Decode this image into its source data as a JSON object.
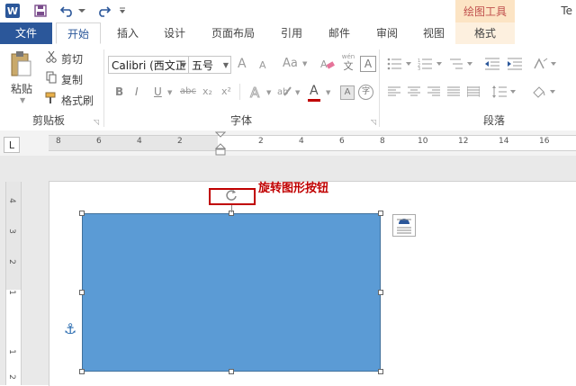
{
  "titlebar": {
    "app_icon_letter": "W",
    "context_tab_title": "绘图工具",
    "doc_title_partial": "Te"
  },
  "tabs": {
    "file": "文件",
    "home": "开始",
    "insert": "插入",
    "design": "设计",
    "page_layout": "页面布局",
    "references": "引用",
    "mailings": "邮件",
    "review": "审阅",
    "view": "视图",
    "format": "格式"
  },
  "clipboard": {
    "paste": "粘贴",
    "cut": "剪切",
    "copy": "复制",
    "format_painter": "格式刷",
    "group_label": "剪贴板"
  },
  "font": {
    "font_name": "Calibri (西文正",
    "font_size": "五号",
    "group_label": "字体",
    "bold": "B",
    "italic": "I",
    "underline": "U",
    "strike": "abc",
    "subscript": "x₂",
    "superscript": "x²",
    "grow": "A",
    "shrink": "A",
    "change_case": "Aa",
    "phonetic_top": "wén",
    "phonetic_bottom": "文",
    "char_border": "A",
    "font_color": "A",
    "enclose": "字"
  },
  "paragraph": {
    "group_label": "段落"
  },
  "ruler": {
    "corner": "L",
    "h_numbers": [
      "8",
      "6",
      "4",
      "2",
      "2",
      "4",
      "6",
      "8",
      "10",
      "12",
      "14",
      "16",
      "18"
    ],
    "v_numbers": [
      "4",
      "3",
      "2",
      "1",
      "1",
      "2"
    ]
  },
  "document": {
    "callout_text": "旋转图形按钮",
    "shape_color": "#5b9bd5",
    "callout_color": "#c00000"
  },
  "colors": {
    "accent": "#2b579a",
    "context_tab_bg": "#fce4c4",
    "context_tab_text": "#c0504d"
  }
}
